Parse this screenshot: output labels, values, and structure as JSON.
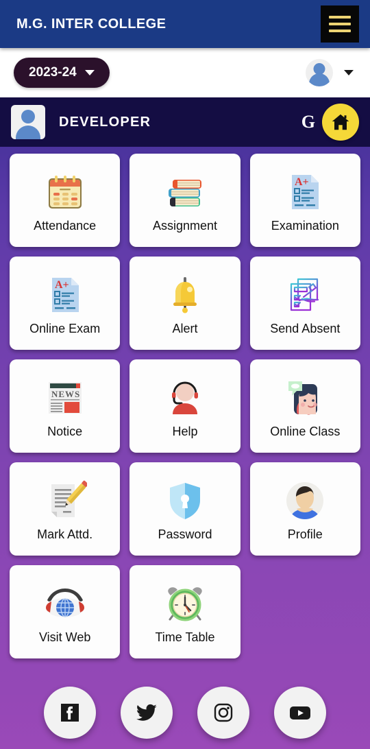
{
  "appbar": {
    "title": "M.G. INTER COLLEGE",
    "menu_icon": "hamburger-menu-icon"
  },
  "session": {
    "year": "2023-24",
    "year_caret_icon": "chevron-down-icon",
    "profile_icon": "user-avatar-icon",
    "profile_caret_icon": "chevron-down-icon"
  },
  "user": {
    "avatar_icon": "user-avatar-icon",
    "name": "DEVELOPER",
    "google_label": "G",
    "home_icon": "home-icon"
  },
  "grid": {
    "tiles": [
      {
        "label": "Attendance",
        "icon": "calendar-icon"
      },
      {
        "label": "Assignment",
        "icon": "books-stack-icon"
      },
      {
        "label": "Examination",
        "icon": "exam-paper-a-plus-icon"
      },
      {
        "label": "Online Exam",
        "icon": "exam-paper-a-plus-icon"
      },
      {
        "label": "Alert",
        "icon": "bell-icon"
      },
      {
        "label": "Send Absent",
        "icon": "hand-writing-checklist-icon"
      },
      {
        "label": "Notice",
        "icon": "newspaper-icon"
      },
      {
        "label": "Help",
        "icon": "headset-support-agent-icon"
      },
      {
        "label": "Online Class",
        "icon": "video-call-student-icon"
      },
      {
        "label": "Mark Attd.",
        "icon": "document-pencil-icon"
      },
      {
        "label": "Password",
        "icon": "shield-keyhole-icon"
      },
      {
        "label": "Profile",
        "icon": "person-portrait-icon"
      },
      {
        "label": "Visit Web",
        "icon": "eye-globe-icon"
      },
      {
        "label": "Time Table",
        "icon": "alarm-clock-icon"
      }
    ]
  },
  "social": {
    "items": [
      {
        "name": "facebook",
        "icon": "facebook-icon"
      },
      {
        "name": "twitter",
        "icon": "twitter-icon"
      },
      {
        "name": "instagram",
        "icon": "instagram-icon"
      },
      {
        "name": "youtube",
        "icon": "youtube-icon"
      }
    ]
  },
  "colors": {
    "appbar_blue": "#1b3a85",
    "userbar_navy": "#140d43",
    "pill_dark": "#2b112b",
    "home_yellow": "#f5d838",
    "menu_gold": "#edd473",
    "bg_top": "#241a52",
    "bg_bottom": "#9a49b8"
  }
}
